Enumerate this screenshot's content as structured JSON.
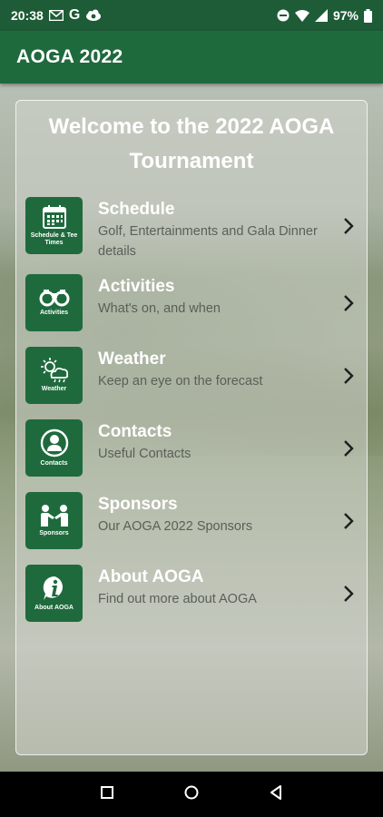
{
  "status_bar": {
    "time": "20:38",
    "battery": "97%",
    "icons": [
      "gmail-icon",
      "google-icon",
      "cloud-icon",
      "do-not-disturb-icon",
      "wifi-icon",
      "signal-icon",
      "battery-icon"
    ]
  },
  "app_bar": {
    "title": "AOGA 2022"
  },
  "welcome": {
    "text": "Welcome to the 2022 AOGA Tournament"
  },
  "menu": [
    {
      "icon": "calendar-icon",
      "caption": "Schedule & Tee Times",
      "title": "Schedule",
      "subtitle": "Golf, Entertainments and Gala Dinner details"
    },
    {
      "icon": "binoculars-icon",
      "caption": "Activities",
      "title": "Activities",
      "subtitle": "What's on, and when"
    },
    {
      "icon": "weather-icon",
      "caption": "Weather",
      "title": "Weather",
      "subtitle": "Keep an eye on the forecast"
    },
    {
      "icon": "contact-icon",
      "caption": "Contacts",
      "title": "Contacts",
      "subtitle": "Useful Contacts"
    },
    {
      "icon": "handshake-icon",
      "caption": "Sponsors",
      "title": "Sponsors",
      "subtitle": "Our AOGA 2022 Sponsors"
    },
    {
      "icon": "info-icon",
      "caption": "About AOGA",
      "title": "About AOGA",
      "subtitle": "Find out more  about AOGA"
    }
  ],
  "nav_bar": {
    "icons": [
      "recents-icon",
      "home-icon",
      "back-icon"
    ]
  },
  "colors": {
    "primary": "#1f6a3d",
    "status": "#1d5c36"
  }
}
